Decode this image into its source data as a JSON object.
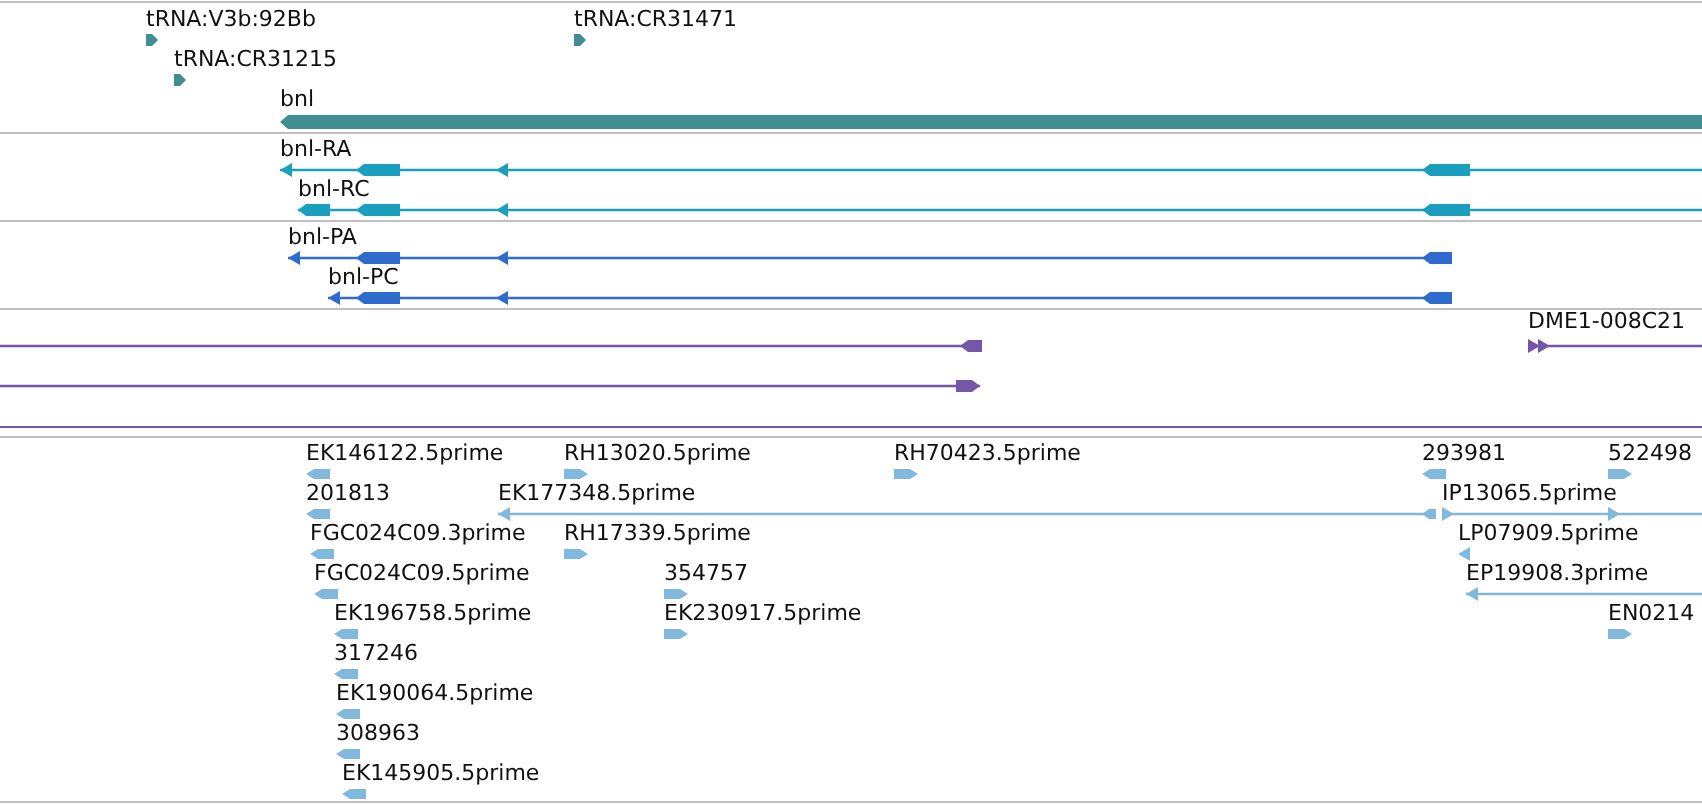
{
  "tracks": [
    {
      "features": [
        {
          "label": "tRNA:V3b:92Bb",
          "reverse": false
        },
        {
          "label": "tRNA:CR31215",
          "reverse": false
        },
        {
          "label": "tRNA:CR31471",
          "reverse": false
        },
        {
          "label": "bnl",
          "reverse": true
        }
      ]
    },
    {
      "features": [
        {
          "label": "bnl-RA",
          "reverse": true
        },
        {
          "label": "bnl-RC",
          "reverse": true
        }
      ]
    },
    {
      "features": [
        {
          "label": "bnl-PA",
          "reverse": true
        },
        {
          "label": "bnl-PC",
          "reverse": true
        }
      ]
    },
    {
      "features": [
        {
          "reverse": true
        },
        {
          "reverse": false
        },
        {
          "label": "DME1-008C21",
          "reverse": false
        }
      ]
    },
    {
      "features": [
        {
          "label": "EK146122.5prime",
          "reverse": true
        },
        {
          "label": "RH13020.5prime",
          "reverse": false
        },
        {
          "label": "RH70423.5prime",
          "reverse": false
        },
        {
          "label": "293981",
          "reverse": true
        },
        {
          "label": "522498",
          "reverse": false
        },
        {
          "label": "201813",
          "reverse": true
        },
        {
          "label": "EK177348.5prime",
          "reverse": true
        },
        {
          "label": "IP13065.5prime",
          "reverse": false
        },
        {
          "label": "FGC024C09.3prime",
          "reverse": true
        },
        {
          "label": "RH17339.5prime",
          "reverse": false
        },
        {
          "label": "LP07909.5prime",
          "reverse": true
        },
        {
          "label": "FGC024C09.5prime",
          "reverse": true
        },
        {
          "label": "354757",
          "reverse": false
        },
        {
          "label": "EP19908.3prime",
          "reverse": true
        },
        {
          "label": "EK196758.5prime",
          "reverse": true
        },
        {
          "label": "EK230917.5prime",
          "reverse": false
        },
        {
          "label": "EN0214",
          "reverse": false
        },
        {
          "label": "317246",
          "reverse": true
        },
        {
          "label": "EK190064.5prime",
          "reverse": true
        },
        {
          "label": "308963",
          "reverse": true
        },
        {
          "label": "EK145905.5prime",
          "reverse": true
        }
      ]
    }
  ]
}
